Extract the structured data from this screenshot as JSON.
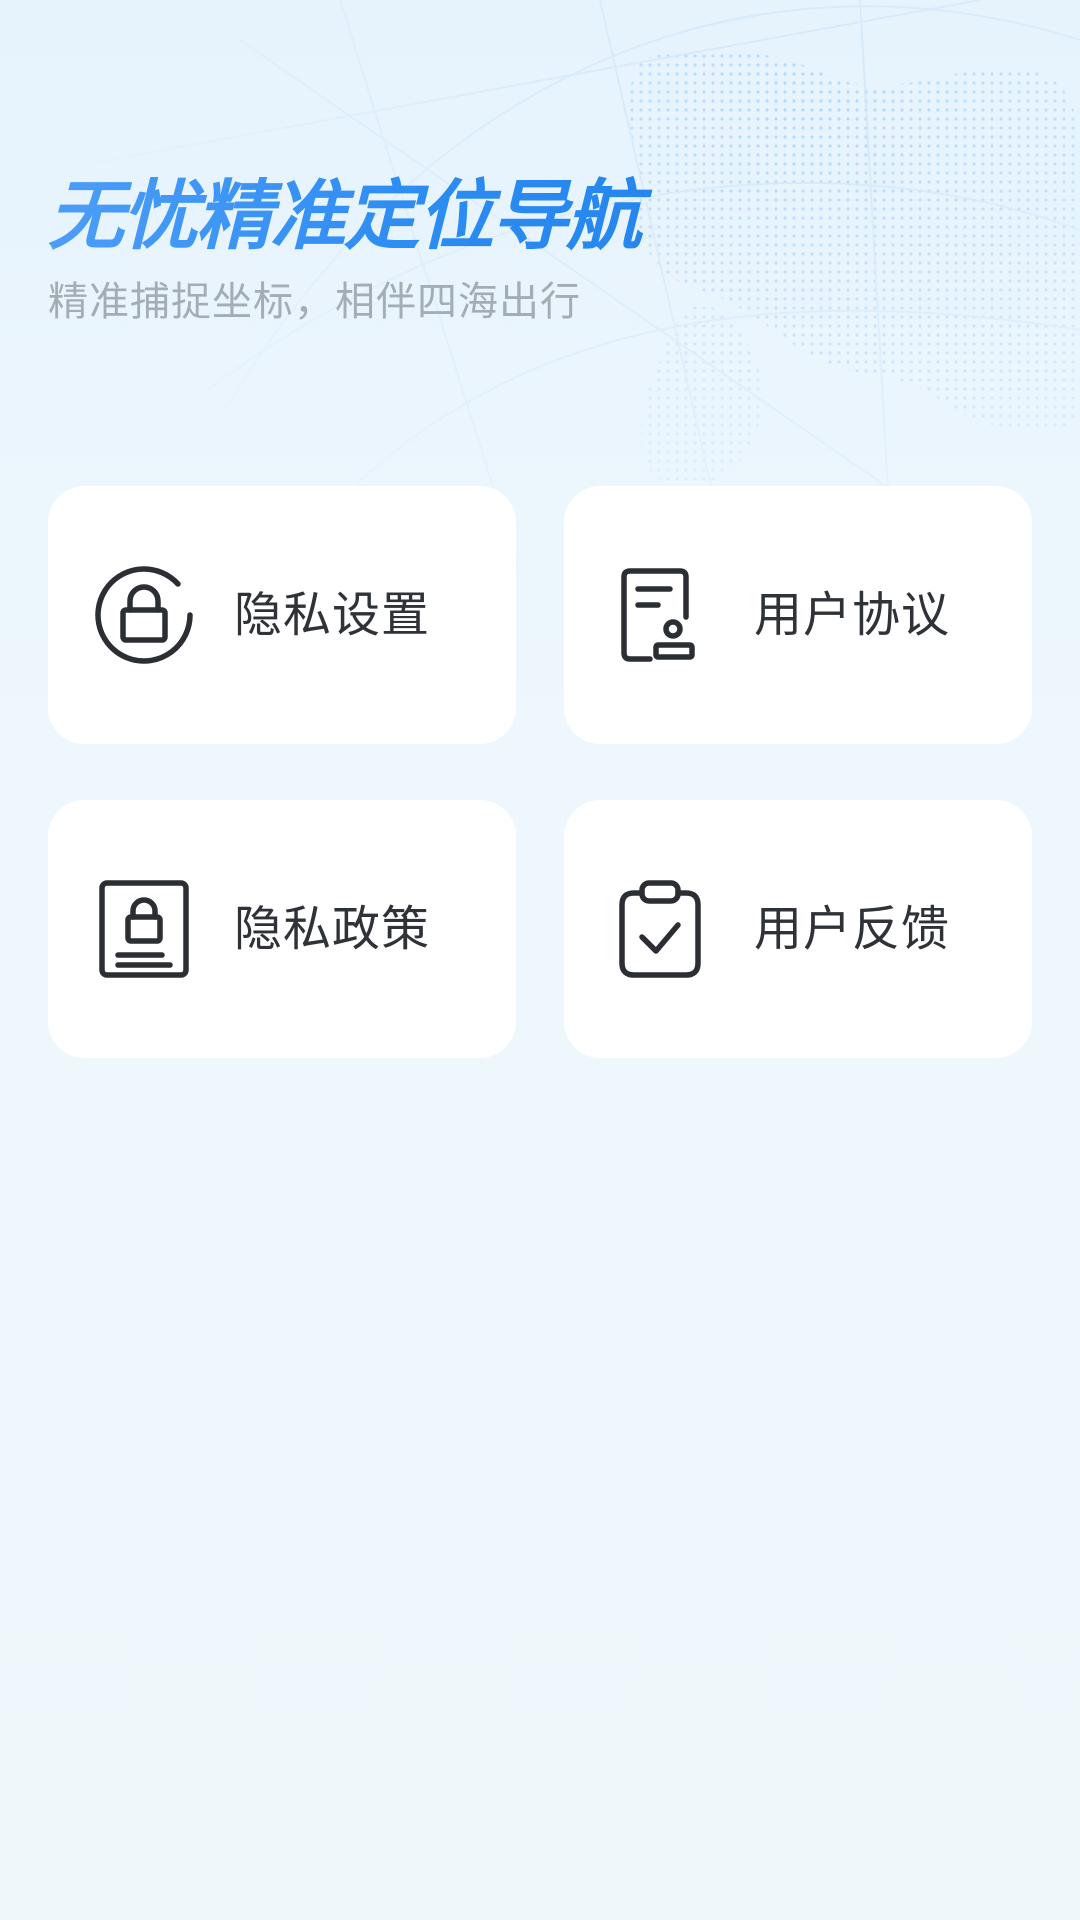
{
  "hero": {
    "title": "无忧精准定位导航",
    "subtitle": "精准捕捉坐标，相伴四海出行"
  },
  "menu": {
    "items": [
      {
        "label": "隐私设置",
        "icon": "lock-refresh-icon"
      },
      {
        "label": "用户协议",
        "icon": "document-stamp-icon"
      },
      {
        "label": "隐私政策",
        "icon": "privacy-document-icon"
      },
      {
        "label": "用户反馈",
        "icon": "clipboard-check-icon"
      }
    ]
  },
  "colors": {
    "title_gradient_start": "#4c9df8",
    "title_gradient_end": "#1f7fe8",
    "subtitle": "#a4adb6",
    "card_background": "#ffffff",
    "card_text": "#2f3337",
    "icon_stroke": "#2b2e33",
    "page_background": "#eef7fd"
  }
}
